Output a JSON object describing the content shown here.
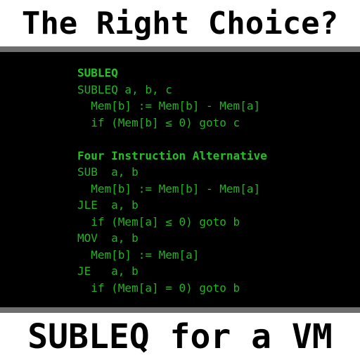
{
  "top_title": "The Right Choice?",
  "bottom_title": "SUBLEQ for a VM",
  "colors": {
    "background": "#ffffff",
    "divider": "#6e6e6e",
    "code_background": "#000000",
    "code_text": "#22b422"
  },
  "code": {
    "lines": [
      "SUBLEQ",
      "SUBLEQ a, b, c",
      "  Mem[b] := Mem[b] - Mem[a]",
      "  if (Mem[b] ≤ 0) goto c",
      "",
      "Four Instruction Alternative",
      "SUB  a, b",
      "  Mem[b] := Mem[b] - Mem[a]",
      "JLE  a, b",
      "  if (Mem[a] ≤ 0) goto b",
      "MOV  a, b",
      "  Mem[b] := Mem[a]",
      "JE   a, b",
      "  if (Mem[a] = 0) goto b"
    ]
  }
}
